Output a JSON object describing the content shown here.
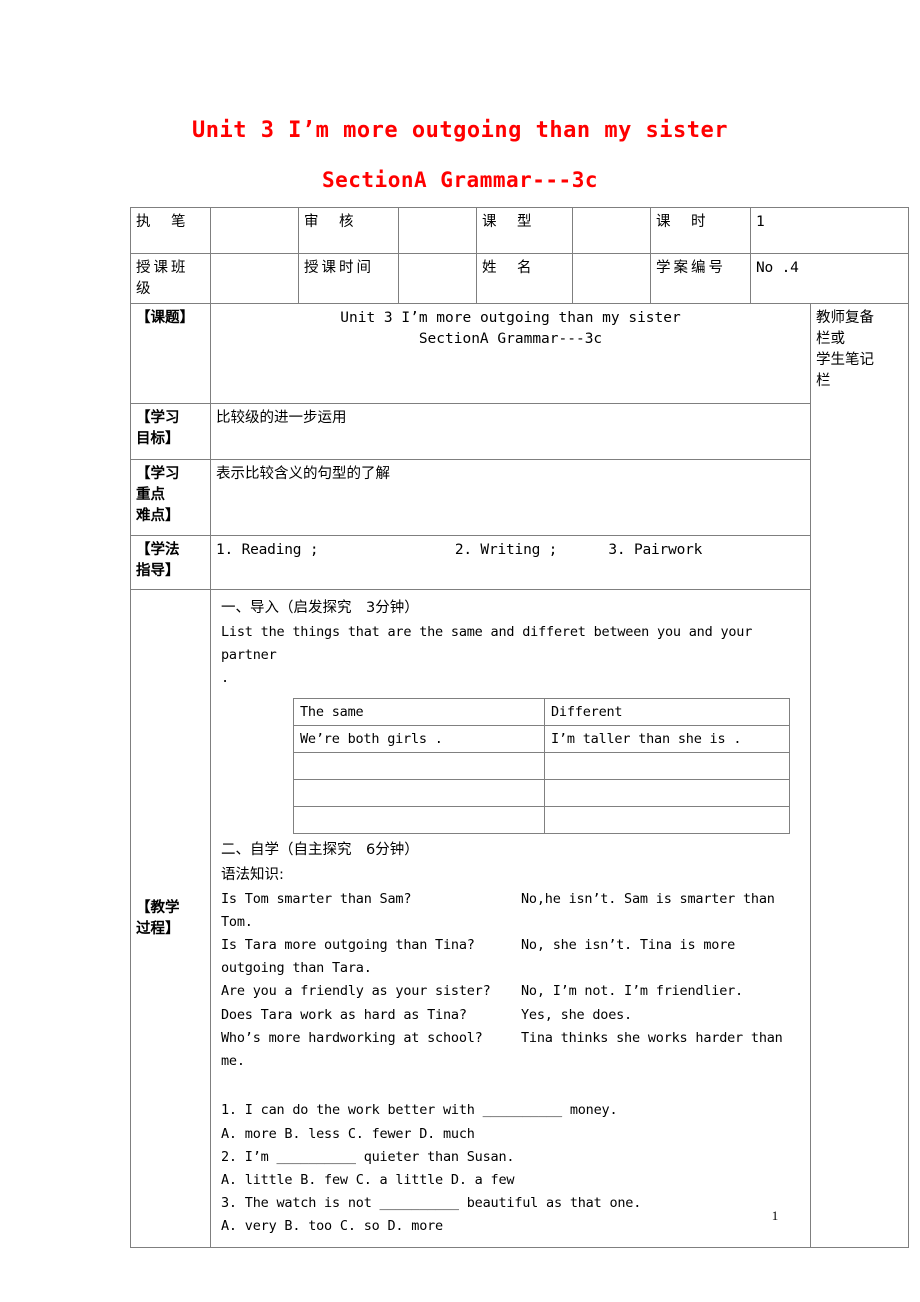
{
  "document": {
    "title_line1": "Unit 3 I’m more outgoing than my sister",
    "title_line2": "SectionA Grammar---3c",
    "title_color": "#FF0000",
    "page_number": "1"
  },
  "meta_row1": {
    "label_author": "执　笔",
    "value_author": "",
    "label_review": "审　核",
    "value_review": "",
    "label_type": "课　型",
    "value_type": "",
    "label_periods": "课　时",
    "value_periods": "1"
  },
  "meta_row2": {
    "label_class": "授课班级",
    "value_class": "",
    "label_time": "授课时间",
    "value_time": "",
    "label_name": "姓　名",
    "value_name": "",
    "label_plan_no": "学案编号",
    "value_plan_no": "No .4"
  },
  "notes_column": {
    "line1": "教师复备",
    "line2": "栏或",
    "line3": "学生笔记",
    "line4": "栏"
  },
  "rows": {
    "topic": {
      "label": "【课题】",
      "content_line1": "Unit 3 I’m more outgoing than my sister",
      "content_line2": "SectionA Grammar---3c"
    },
    "objective": {
      "label": "【学习目标】",
      "label_l1": "【学习",
      "label_l2": "目标】",
      "content": "比较级的进一步运用"
    },
    "keypoints": {
      "label_l1": "【学习",
      "label_l2": "重点",
      "label_l3": "难点】",
      "content": "表示比较含义的句型的了解"
    },
    "methods": {
      "label_l1": "【学法",
      "label_l2": "指导】",
      "content": "1. Reading ;                2. Writing ;      3. Pairwork"
    },
    "process": {
      "label_l1": "【教学",
      "label_l2": "过程】"
    }
  },
  "process": {
    "section1_heading": "一、导入（启发探究　3分钟）",
    "section1_text": "List the things that are the same and differet between you and your partner",
    "section1_text_tail": ".",
    "inner_table": {
      "headers": [
        "The same",
        "Different"
      ],
      "rows": [
        [
          "We’re both girls .",
          "I’m taller than she is ."
        ],
        [
          "",
          ""
        ],
        [
          "",
          ""
        ],
        [
          "",
          ""
        ]
      ]
    },
    "section2_heading": "二、自学（自主探究　6分钟）",
    "section2_subheading": "语法知识:",
    "qa": [
      {
        "question": "Is Tom smarter than Sam?",
        "answer": "No,he isn’t. Sam is smarter than Tom."
      },
      {
        "question": "Is Tara more outgoing than Tina?",
        "answer": "No, she isn’t. Tina is more outgoing than Tara."
      },
      {
        "question": "Are you a friendly as your sister?",
        "answer": "No, I’m not. I’m friendlier."
      },
      {
        "question": "Does Tara work as hard as Tina?",
        "answer": "Yes, she does."
      },
      {
        "question": "Who’s more hardworking at school?",
        "answer": "Tina thinks she works harder than me."
      }
    ],
    "exercises": [
      {
        "stem": "1. I can do the work better with __________ money.",
        "options": "A. more B. less C. fewer D. much"
      },
      {
        "stem": "2. I’m __________ quieter than Susan.",
        "options": "A. little B. few C. a little D. a few"
      },
      {
        "stem": "3. The watch is not __________ beautiful as that one.",
        "options": "A. very B. too C. so D. more"
      }
    ]
  }
}
